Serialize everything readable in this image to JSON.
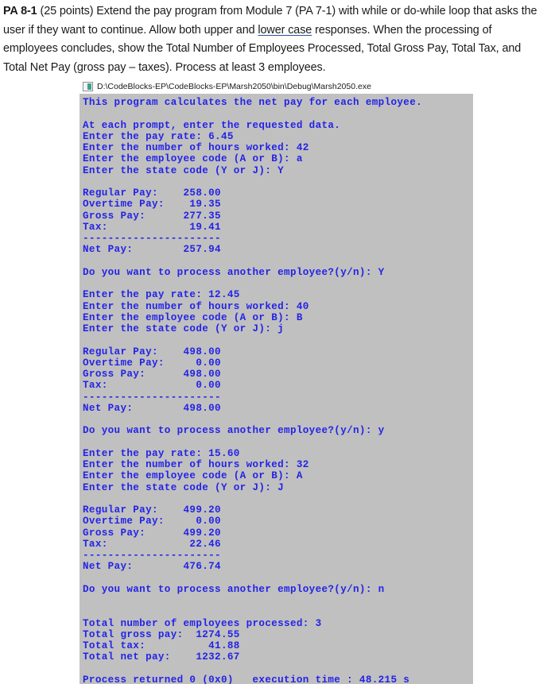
{
  "assignment": {
    "label": "PA 8-1",
    "points": "(25 points)",
    "text_part_1": " Extend the pay program from Module 7 (PA 7-1) with while or do-while loop that asks the user if they want to continue. Allow both upper and ",
    "link_text": "lower case",
    "text_part_2": " responses. When the processing of employees concludes, show the Total Number of Employees Processed, Total Gross Pay, Total Tax, and Total Net Pay (gross pay – taxes). Process at least 3 employees.",
    "link_color": "#2b4fa0"
  },
  "console": {
    "icon": "console-app-icon",
    "title": "D:\\CodeBlocks-EP\\CodeBlocks-EP\\Marsh2050\\bin\\Debug\\Marsh2050.exe",
    "background_color": "#c0c0c0",
    "text_color": "#2323e8",
    "output": "This program calculates the net pay for each employee.\n\nAt each prompt, enter the requested data.\nEnter the pay rate: 6.45\nEnter the number of hours worked: 42\nEnter the employee code (A or B): a\nEnter the state code (Y or J): Y\n\nRegular Pay:    258.00\nOvertime Pay:    19.35\nGross Pay:      277.35\nTax:             19.41\n----------------------\nNet Pay:        257.94\n\nDo you want to process another employee?(y/n): Y\n\nEnter the pay rate: 12.45\nEnter the number of hours worked: 40\nEnter the employee code (A or B): B\nEnter the state code (Y or J): j\n\nRegular Pay:    498.00\nOvertime Pay:     0.00\nGross Pay:      498.00\nTax:              0.00\n----------------------\nNet Pay:        498.00\n\nDo you want to process another employee?(y/n): y\n\nEnter the pay rate: 15.60\nEnter the number of hours worked: 32\nEnter the employee code (A or B): A\nEnter the state code (Y or J): J\n\nRegular Pay:    499.20\nOvertime Pay:     0.00\nGross Pay:      499.20\nTax:             22.46\n----------------------\nNet Pay:        476.74\n\nDo you want to process another employee?(y/n): n\n\n\nTotal number of employees processed: 3\nTotal gross pay:  1274.55\nTotal tax:          41.88\nTotal net pay:    1232.67\n\nProcess returned 0 (0x0)   execution time : 48.215 s",
    "session": {
      "intro_line": "This program calculates the net pay for each employee.",
      "prompt_header": "At each prompt, enter the requested data.",
      "prompts": {
        "pay_rate": "Enter the pay rate:",
        "hours_worked": "Enter the number of hours worked:",
        "employee_code": "Enter the employee code (A or B):",
        "state_code": "Enter the state code (Y or J):",
        "continue": "Do you want to process another employee?(y/n):"
      },
      "result_labels": {
        "regular_pay": "Regular Pay:",
        "overtime_pay": "Overtime Pay:",
        "gross_pay": "Gross Pay:",
        "tax": "Tax:",
        "separator": "----------------------",
        "net_pay": "Net Pay:"
      },
      "employees": [
        {
          "pay_rate": "6.45",
          "hours_worked": "42",
          "employee_code": "a",
          "state_code": "Y",
          "regular_pay": "258.00",
          "overtime_pay": "19.35",
          "gross_pay": "277.35",
          "tax": "19.41",
          "net_pay": "257.94",
          "continue_answer": "Y"
        },
        {
          "pay_rate": "12.45",
          "hours_worked": "40",
          "employee_code": "B",
          "state_code": "j",
          "regular_pay": "498.00",
          "overtime_pay": "0.00",
          "gross_pay": "498.00",
          "tax": "0.00",
          "net_pay": "498.00",
          "continue_answer": "y"
        },
        {
          "pay_rate": "15.60",
          "hours_worked": "32",
          "employee_code": "A",
          "state_code": "J",
          "regular_pay": "499.20",
          "overtime_pay": "0.00",
          "gross_pay": "499.20",
          "tax": "22.46",
          "net_pay": "476.74",
          "continue_answer": "n"
        }
      ],
      "totals": {
        "employees_processed_label": "Total number of employees processed:",
        "employees_processed": "3",
        "gross_pay_label": "Total gross pay:",
        "gross_pay": "1274.55",
        "tax_label": "Total tax:",
        "tax": "41.88",
        "net_pay_label": "Total net pay:",
        "net_pay": "1232.67"
      }
    }
  }
}
